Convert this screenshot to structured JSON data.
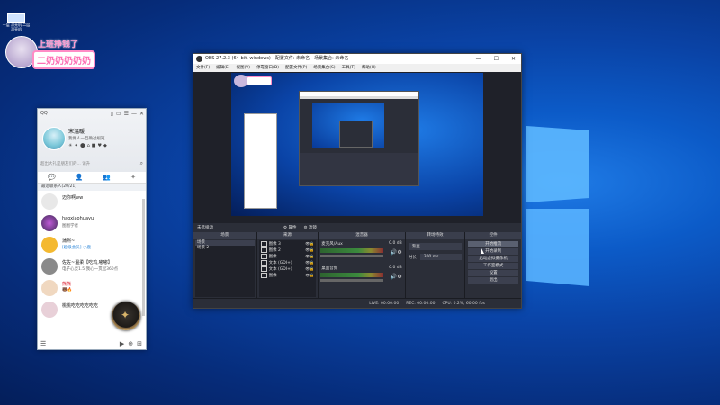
{
  "desktop": {
    "icon_label": "一层 漂亮机\n二层 漂亮机",
    "sticker_line1": "上班挣钱了",
    "sticker_line2": "二奶奶奶奶奶"
  },
  "qq": {
    "app_label": "QQ",
    "window_controls": [
      "▯",
      "▭",
      "☰",
      "—",
      "✕"
    ],
    "nickname": "宋温暖",
    "signature": "我做人一旦确过规矩……",
    "badges": [
      "☀",
      "♦",
      "⬤",
      "⌂",
      "■",
      "♥",
      "◆"
    ],
    "search_placeholder": "超出大礼是朋友们的... 请升",
    "tabs": [
      "💬",
      "👤",
      "👥",
      "✦"
    ],
    "section_title": "最近联系人(20/21)",
    "contacts": [
      {
        "name": "迈你啊ww",
        "status": "",
        "color": "#e8e8e8"
      },
      {
        "name": "haoxiaohuayu",
        "status": "图图学者",
        "color": "#402a58"
      },
      {
        "name": "蒲熙~",
        "status": "[超级会员] 小鹿",
        "color": "#f4b930"
      },
      {
        "name": "佐佐~温柔【吃鸡,嘟嘟】",
        "status": "电子心灵1.5 我心一贯起360点",
        "color": "#8a8a8a"
      },
      {
        "name": "熊熊",
        "status": "🐻🔥",
        "color": "#f0d8c0"
      },
      {
        "name": "桃桃吃吃吃吃吃吃",
        "status": "",
        "color": "#e8d0d8"
      }
    ],
    "bottom_left": "☰",
    "bottom_right": [
      "▶",
      "⊕",
      "⊞"
    ]
  },
  "obs": {
    "title": "OBS 27.2.3 (64-bit, windows) - 配置文件: 未命名 - 场景集合: 未命名",
    "window_controls": [
      "—",
      "☐",
      "✕"
    ],
    "menu": [
      "文件(F)",
      "编辑(E)",
      "视图(V)",
      "停靠窗口(D)",
      "配置文件(P)",
      "场景集合(S)",
      "工具(T)",
      "帮助(H)"
    ],
    "preview_status": "未选择源",
    "preview_buttons": [
      "⚙ 属性",
      "⚙ 滤镜"
    ],
    "docks": {
      "scenes": {
        "title": "场景",
        "items": [
          "场景",
          "场景 2"
        ],
        "footer": "+ — ∧ ∨"
      },
      "sources": {
        "title": "来源",
        "items": [
          "图像 3",
          "图像 2",
          "图像",
          "文本 (GDI+)",
          "文本 (GDI+)",
          "图像"
        ],
        "footer": "+ — ⚙ ∧ ∨"
      },
      "mixer": {
        "title": "混音器",
        "channels": [
          {
            "name": "麦克风/Aux",
            "db": "0.0 dB"
          },
          {
            "name": "桌面音频",
            "db": "0.0 dB"
          }
        ]
      },
      "transitions": {
        "title": "转场特效",
        "type": "渐变",
        "duration_label": "时长",
        "duration_value": "300 ms"
      },
      "controls": {
        "title": "控件",
        "buttons": [
          "开始推流",
          "开始录制",
          "启动虚拟摄像机",
          "工作室模式",
          "设置",
          "退出"
        ]
      }
    },
    "status": {
      "live": "LIVE: 00:00:00",
      "rec": "REC: 00:00:00",
      "cpu": "CPU: 0.2%, 60.00 fps"
    }
  }
}
